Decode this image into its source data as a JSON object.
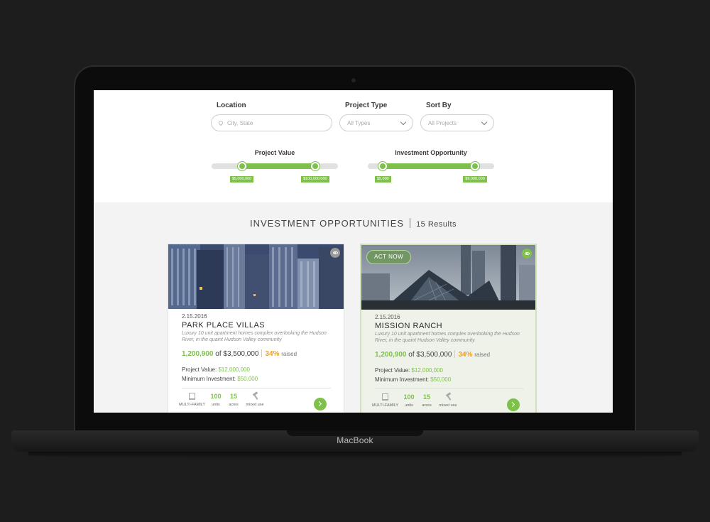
{
  "device": {
    "brand": "MacBook"
  },
  "filters": {
    "location_label": "Location",
    "location_placeholder": "City, State",
    "project_type_label": "Project Type",
    "project_type_value": "All Types",
    "sort_by_label": "Sort By",
    "sort_by_value": "All Projects"
  },
  "sliders": {
    "project_value": {
      "label": "Project Value",
      "min_tag": "$5,000,000",
      "max_tag": "$100,000,000",
      "low_fraction": 0.24,
      "high_fraction": 0.82
    },
    "investment_opportunity": {
      "label": "Investment Opportunity",
      "min_tag": "$5,000",
      "max_tag": "$9,000,000",
      "low_fraction": 0.12,
      "high_fraction": 0.85
    }
  },
  "listing": {
    "title": "INVESTMENT OPPORTUNITIES",
    "count": "15 Results"
  },
  "cards": [
    {
      "act_label": "",
      "date": "2.15.2016",
      "title": "PARK PLACE VILLAS",
      "description": "Luxury 10 unit apartment homes complex overlooking the Hudson River, in the quaint Hudson Valley community",
      "raised_amount": "1,200,900",
      "of_label": "of",
      "goal": "$3,500,000",
      "percent": "34%",
      "raised_label": "raised",
      "project_value_label": "Project Value:",
      "project_value": "$12,000,000",
      "min_investment_label": "Minimum Investment:",
      "min_investment": "$50,000",
      "stats": {
        "type": "MULTI-FAMILY",
        "units_value": "100",
        "units_label": "units",
        "acres_value": "15",
        "acres_label": "acres",
        "use_label": "mixed use"
      }
    },
    {
      "act_label": "ACT NOW",
      "date": "2.15.2016",
      "title": "MISSION RANCH",
      "description": "Luxury 10 unit apartment homes complex overlooking the Hudson River, in the quaint Hudson Valley community",
      "raised_amount": "1,200,900",
      "of_label": "of",
      "goal": "$3,500,000",
      "percent": "34%",
      "raised_label": "raised",
      "project_value_label": "Project Value:",
      "project_value": "$12,000,000",
      "min_investment_label": "Minimum Investment:",
      "min_investment": "$50,000",
      "stats": {
        "type": "MULTI-FAMILY",
        "units_value": "100",
        "units_label": "units",
        "acres_value": "15",
        "acres_label": "acres",
        "use_label": "mixed use"
      }
    }
  ],
  "colors": {
    "accent": "#7ec14a",
    "percent": "#f0a020"
  }
}
